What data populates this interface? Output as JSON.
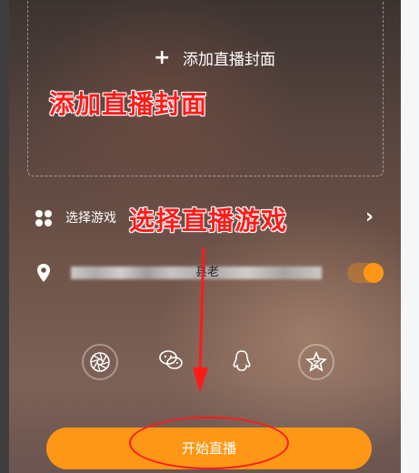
{
  "cover": {
    "plus": "+",
    "label": "添加直播封面"
  },
  "annotations": {
    "cover": "添加直播封面",
    "game": "选择直播游戏"
  },
  "game_row": {
    "label": "选择游戏",
    "chevron": "›"
  },
  "location_row": {
    "partial_text": "县老",
    "toggle_on": true
  },
  "share_icons": [
    "moments-icon",
    "wechat-icon",
    "qq-icon",
    "qzone-icon"
  ],
  "start_button": {
    "label": "开始直播"
  },
  "colors": {
    "accent": "#ff9716",
    "annotation": "#ff1a1a"
  }
}
